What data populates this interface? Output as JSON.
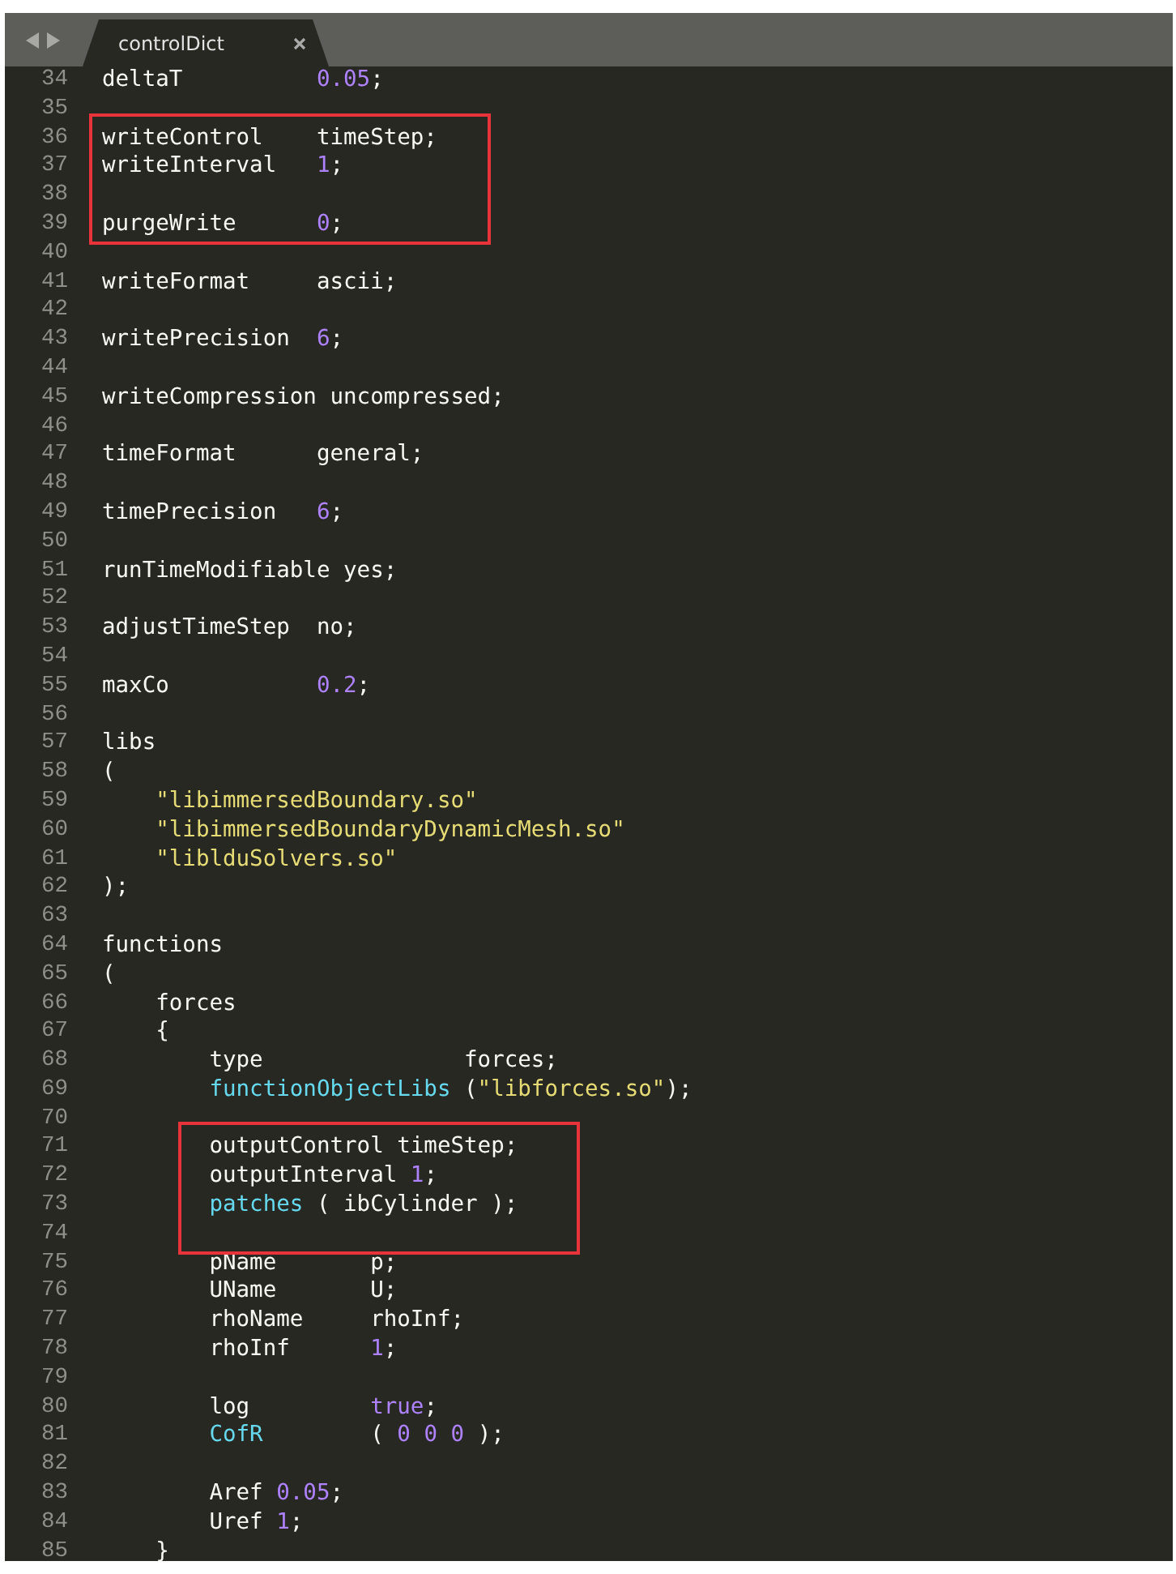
{
  "tab": {
    "title": "controlDict",
    "selected": true
  },
  "lines": [
    {
      "number": "34",
      "tokens": [
        {
          "text": "deltaT          ",
          "kind": "plain"
        },
        {
          "text": "0.05",
          "kind": "number"
        },
        {
          "text": ";",
          "kind": "plain"
        }
      ]
    },
    {
      "number": "35"
    },
    {
      "number": "36",
      "boxed": true,
      "tokens": [
        {
          "text": "writeControl    timeStep;",
          "kind": "plain"
        }
      ]
    },
    {
      "number": "37",
      "boxed": true,
      "tokens": [
        {
          "text": "writeInterval   ",
          "kind": "plain"
        },
        {
          "text": "1",
          "kind": "number"
        },
        {
          "text": ";",
          "kind": "plain"
        }
      ]
    },
    {
      "number": "38",
      "boxed": true
    },
    {
      "number": "39",
      "boxed": true,
      "tokens": [
        {
          "text": "purgeWrite      ",
          "kind": "plain"
        },
        {
          "text": "0",
          "kind": "number"
        },
        {
          "text": ";",
          "kind": "plain"
        }
      ]
    },
    {
      "number": "40"
    },
    {
      "number": "41",
      "tokens": [
        {
          "text": "writeFormat     ascii;",
          "kind": "plain"
        }
      ]
    },
    {
      "number": "42"
    },
    {
      "number": "43",
      "tokens": [
        {
          "text": "writePrecision  ",
          "kind": "plain"
        },
        {
          "text": "6",
          "kind": "number"
        },
        {
          "text": ";",
          "kind": "plain"
        }
      ]
    },
    {
      "number": "44"
    },
    {
      "number": "45",
      "tokens": [
        {
          "text": "writeCompression uncompressed;",
          "kind": "plain"
        }
      ]
    },
    {
      "number": "46"
    },
    {
      "number": "47",
      "tokens": [
        {
          "text": "timeFormat      general;",
          "kind": "plain"
        }
      ]
    },
    {
      "number": "48"
    },
    {
      "number": "49",
      "tokens": [
        {
          "text": "timePrecision   ",
          "kind": "plain"
        },
        {
          "text": "6",
          "kind": "number"
        },
        {
          "text": ";",
          "kind": "plain"
        }
      ]
    },
    {
      "number": "50"
    },
    {
      "number": "51",
      "tokens": [
        {
          "text": "runTimeModifiable yes;",
          "kind": "plain"
        }
      ]
    },
    {
      "number": "52"
    },
    {
      "number": "53",
      "tokens": [
        {
          "text": "adjustTimeStep  no;",
          "kind": "plain"
        }
      ]
    },
    {
      "number": "54"
    },
    {
      "number": "55",
      "tokens": [
        {
          "text": "maxCo           ",
          "kind": "plain"
        },
        {
          "text": "0.2",
          "kind": "number"
        },
        {
          "text": ";",
          "kind": "plain"
        }
      ]
    },
    {
      "number": "56"
    },
    {
      "number": "57",
      "tokens": [
        {
          "text": "libs",
          "kind": "plain"
        }
      ]
    },
    {
      "number": "58",
      "tokens": [
        {
          "text": "(",
          "kind": "plain"
        }
      ]
    },
    {
      "number": "59",
      "tokens": [
        {
          "text": "    \"libimmersedBoundary.so\"",
          "kind": "string"
        }
      ]
    },
    {
      "number": "60",
      "tokens": [
        {
          "text": "    \"libimmersedBoundaryDynamicMesh.so\"",
          "kind": "string"
        }
      ]
    },
    {
      "number": "61",
      "tokens": [
        {
          "text": "    \"liblduSolvers.so\"",
          "kind": "string"
        }
      ]
    },
    {
      "number": "62",
      "tokens": [
        {
          "text": ");",
          "kind": "plain"
        }
      ]
    },
    {
      "number": "63"
    },
    {
      "number": "64",
      "tokens": [
        {
          "text": "functions",
          "kind": "plain"
        }
      ]
    },
    {
      "number": "65",
      "tokens": [
        {
          "text": "(",
          "kind": "plain"
        }
      ]
    },
    {
      "number": "66",
      "tokens": [
        {
          "text": "    forces",
          "kind": "plain"
        }
      ]
    },
    {
      "number": "67",
      "tokens": [
        {
          "text": "    {",
          "kind": "plain"
        }
      ]
    },
    {
      "number": "68",
      "tokens": [
        {
          "text": "        type               forces;",
          "kind": "plain"
        }
      ]
    },
    {
      "number": "69",
      "tokens": [
        {
          "text": "        functionObjectLibs",
          "kind": "support"
        },
        {
          "text": " (",
          "kind": "plain"
        },
        {
          "text": "\"libforces.so\"",
          "kind": "string"
        },
        {
          "text": ");",
          "kind": "plain"
        }
      ]
    },
    {
      "number": "70"
    },
    {
      "number": "71",
      "boxed": true,
      "tokens": [
        {
          "text": "        outputControl timeStep;",
          "kind": "plain"
        }
      ]
    },
    {
      "number": "72",
      "boxed": true,
      "tokens": [
        {
          "text": "        outputInterval ",
          "kind": "plain"
        },
        {
          "text": "1",
          "kind": "number"
        },
        {
          "text": ";",
          "kind": "plain"
        }
      ]
    },
    {
      "number": "73",
      "boxed": true,
      "tokens": [
        {
          "text": "        patches",
          "kind": "support"
        },
        {
          "text": " ( ibCylinder );",
          "kind": "plain"
        }
      ]
    },
    {
      "number": "74",
      "boxed": true
    },
    {
      "number": "75",
      "tokens": [
        {
          "text": "        pName       p;",
          "kind": "plain"
        }
      ]
    },
    {
      "number": "76",
      "tokens": [
        {
          "text": "        UName       U;",
          "kind": "plain"
        }
      ]
    },
    {
      "number": "77",
      "tokens": [
        {
          "text": "        rhoName     rhoInf;",
          "kind": "plain"
        }
      ]
    },
    {
      "number": "78",
      "tokens": [
        {
          "text": "        rhoInf      ",
          "kind": "plain"
        },
        {
          "text": "1",
          "kind": "number"
        },
        {
          "text": ";",
          "kind": "plain"
        }
      ]
    },
    {
      "number": "79"
    },
    {
      "number": "80",
      "tokens": [
        {
          "text": "        log         ",
          "kind": "plain"
        },
        {
          "text": "true",
          "kind": "number"
        },
        {
          "text": ";",
          "kind": "plain"
        }
      ]
    },
    {
      "number": "81",
      "tokens": [
        {
          "text": "        CofR",
          "kind": "support"
        },
        {
          "text": "        ( ",
          "kind": "plain"
        },
        {
          "text": "0 0 0",
          "kind": "number"
        },
        {
          "text": " );",
          "kind": "plain"
        }
      ]
    },
    {
      "number": "82"
    },
    {
      "number": "83",
      "tokens": [
        {
          "text": "        Aref ",
          "kind": "plain"
        },
        {
          "text": "0.05",
          "kind": "number"
        },
        {
          "text": ";",
          "kind": "plain"
        }
      ]
    },
    {
      "number": "84",
      "tokens": [
        {
          "text": "        Uref ",
          "kind": "plain"
        },
        {
          "text": "1",
          "kind": "number"
        },
        {
          "text": ";",
          "kind": "plain"
        }
      ]
    },
    {
      "number": "85",
      "tokens": [
        {
          "text": "    }",
          "kind": "plain"
        }
      ]
    }
  ]
}
